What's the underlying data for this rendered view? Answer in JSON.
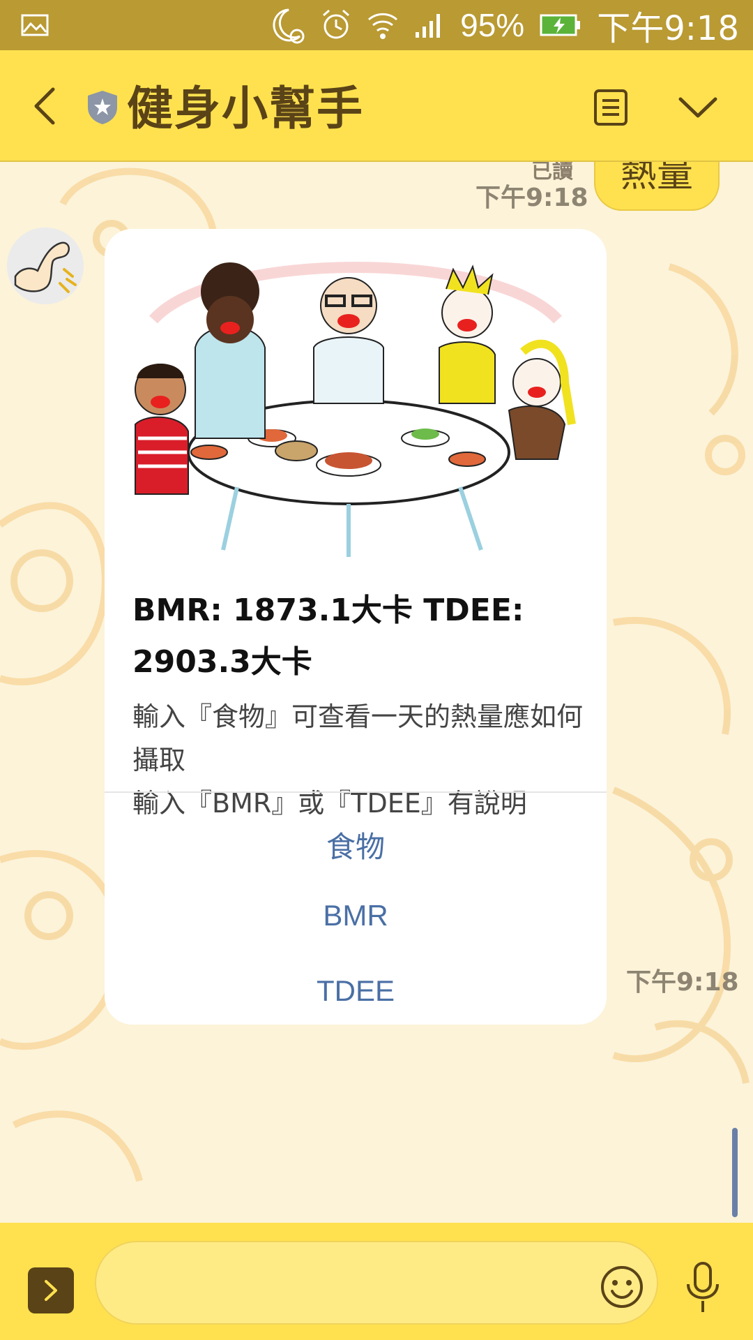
{
  "status_bar": {
    "battery": "95%",
    "time": "下午9:18"
  },
  "header": {
    "title": "健身小幫手"
  },
  "chat": {
    "sent": {
      "read_label": "已讀",
      "time": "下午9:18",
      "text": "熱量"
    },
    "received": {
      "card": {
        "title": "BMR: 1873.1大卡 TDEE: 2903.3大卡",
        "description": "輸入『食物』可查看一天的熱量應如何攝取\n輸入『BMR』或『TDEE』有說明",
        "actions": [
          "食物",
          "BMR",
          "TDEE",
          "back"
        ]
      },
      "time": "下午9:18"
    }
  },
  "colors": {
    "header": "#FFE14F",
    "status_bar": "#B99A33",
    "action_text": "#4A6FA5",
    "title_text": "#5A4317"
  },
  "icons": {
    "gallery": "image-icon",
    "moon": "do-not-disturb-icon",
    "alarm": "alarm-icon",
    "wifi": "wifi-icon",
    "signal": "signal-icon",
    "battery": "battery-charging-icon",
    "back": "chevron-left-icon",
    "shield": "shield-star-icon",
    "notes": "notes-icon",
    "menu": "chevron-down-icon",
    "expand": "chevron-right-icon",
    "emoji": "emoji-icon",
    "mic": "microphone-icon"
  }
}
